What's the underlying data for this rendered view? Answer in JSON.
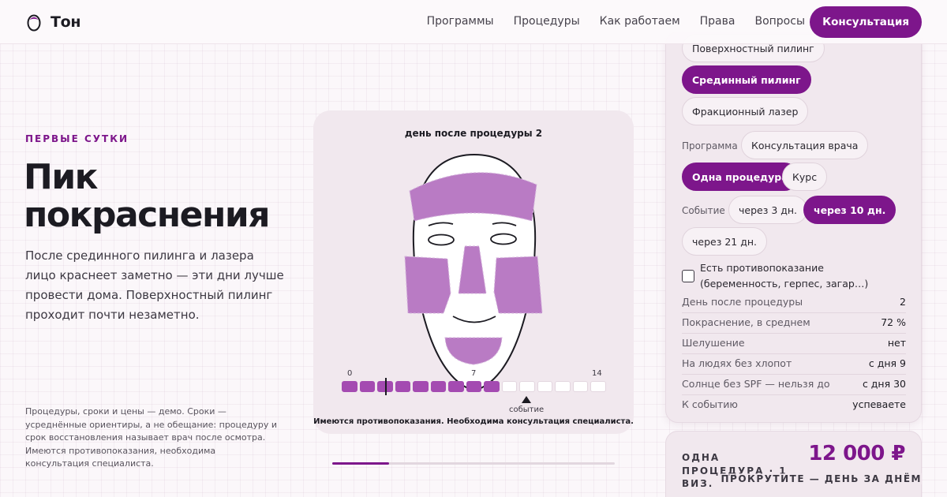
{
  "header": {
    "brand": "Тон",
    "nav": [
      "Программы",
      "Процедуры",
      "Как работаем",
      "Права",
      "Вопросы"
    ],
    "cta": "Консультация"
  },
  "hero": {
    "eyebrow": "ПЕРВЫЕ СУТКИ",
    "title": "Пик покраснения",
    "text": "После срединного пилинга и лазера лицо краснеет заметно — эти дни лучше провести дома. Поверхностный пилинг проходит почти незаметно.",
    "disclaimer": "Процедуры, сроки и цены — демо. Сроки — усреднённые ориентиры, а не обещание: процедуру и срок восстановления называет врач после осмотра. Имеются противопоказания, необходима консультация специалиста."
  },
  "visual": {
    "title": "день после процедуры 2",
    "timeline": {
      "labels": [
        "0",
        "7",
        "14"
      ],
      "total_days": 15,
      "filled_days": 9,
      "current_day": 2,
      "event_day": 10,
      "event_label": "событие"
    },
    "warning": "Имеются противопоказания. Необходима консультация специалиста.",
    "progress_fraction": 0.2
  },
  "panel": {
    "procedures": [
      {
        "label": "Поверхностный пилинг",
        "selected": false
      },
      {
        "label": "Срединный пилинг",
        "selected": true
      },
      {
        "label": "Фракционный лазер",
        "selected": false
      }
    ],
    "program_label": "Программа",
    "programs": [
      {
        "label": "Консультация врача",
        "selected": false
      },
      {
        "label": "Одна процедура",
        "selected": true
      },
      {
        "label": "Курс",
        "selected": false
      }
    ],
    "event_label": "Событие",
    "events": [
      {
        "label": "через 3 дн.",
        "selected": false
      },
      {
        "label": "через 10 дн.",
        "selected": true
      },
      {
        "label": "через 21 дн.",
        "selected": false
      }
    ],
    "contra_label": "Есть противопоказание (беременность, герпес, загар…)",
    "contra_checked": false,
    "stats": [
      {
        "key": "День после процедуры",
        "value": "2"
      },
      {
        "key": "Покраснение, в среднем",
        "value": "72 %"
      },
      {
        "key": "Шелушение",
        "value": "нет"
      },
      {
        "key": "На людях без хлопот",
        "value": "с дня 9"
      },
      {
        "key": "Солнце без SPF — нельзя до",
        "value": "с дня 30"
      },
      {
        "key": "К событию",
        "value": "успеваете"
      }
    ]
  },
  "price": {
    "label": "ОДНА ПРОЦЕДУРА · 1 ВИЗ.",
    "value": "12 000 ₽"
  },
  "scroll_hint": "ПРОКРУТИТЕ — ДЕНЬ ЗА ДНЁМ",
  "colors": {
    "accent": "#7d168b",
    "redness_zone": "#b97bc4",
    "timeline_fill": "#a44bb1"
  }
}
